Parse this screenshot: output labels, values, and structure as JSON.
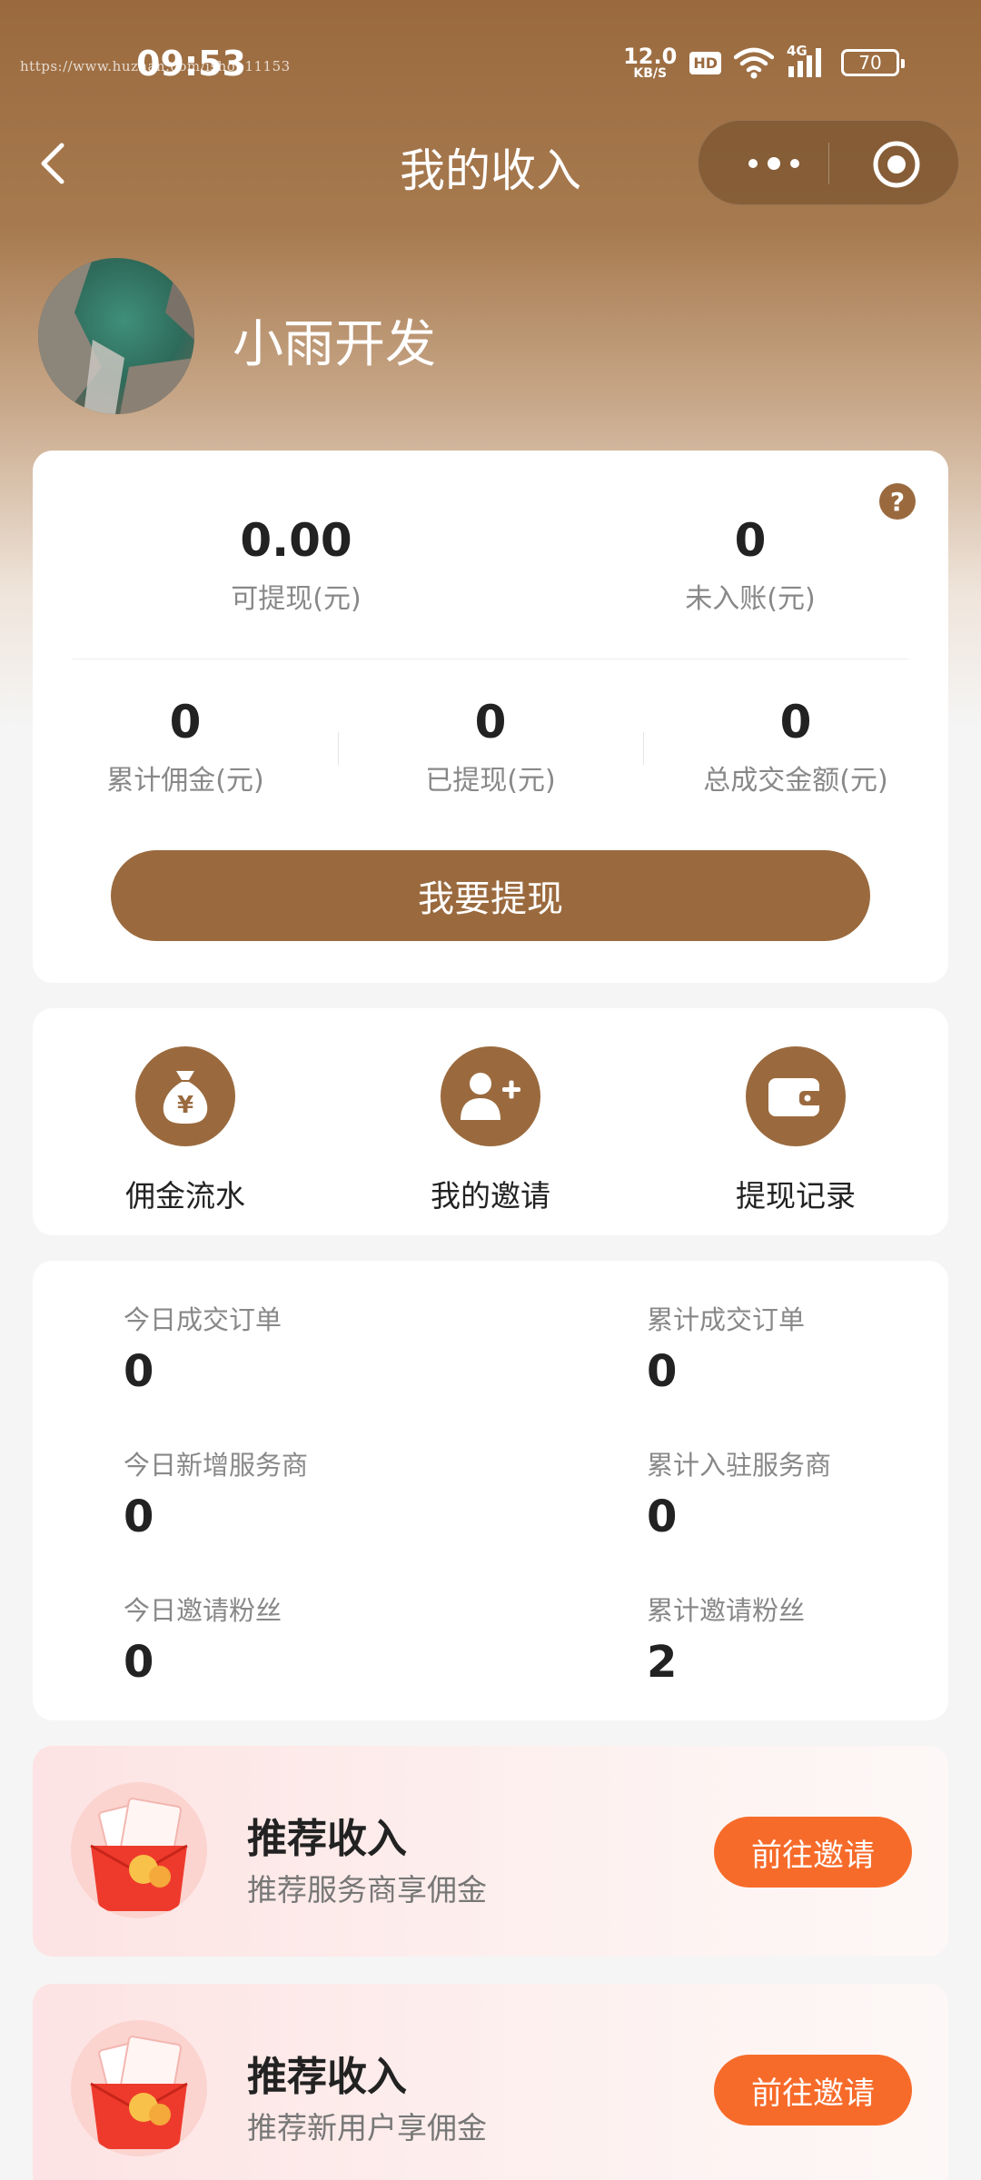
{
  "status_bar": {
    "time": "09:53",
    "watermark": "https://www.huzhan.com/ishop11153",
    "net_speed_value": "12.0",
    "net_speed_unit": "KB/S",
    "hd": "HD",
    "signal": "4G",
    "battery": "70"
  },
  "nav": {
    "title": "我的收入",
    "icons": [
      "back-icon",
      "more-icon",
      "close-target-icon"
    ]
  },
  "profile": {
    "name": "小雨开发"
  },
  "stats": {
    "help": "?",
    "withdrawable": {
      "value": "0.00",
      "label": "可提现(元)"
    },
    "pending": {
      "value": "0",
      "label": "未入账(元)"
    },
    "total_commission": {
      "value": "0",
      "label": "累计佣金(元)"
    },
    "withdrawn": {
      "value": "0",
      "label": "已提现(元)"
    },
    "total_deal": {
      "value": "0",
      "label": "总成交金额(元)"
    },
    "withdraw_button": "我要提现"
  },
  "menu": {
    "items": [
      {
        "label": "佣金流水",
        "icon": "money-bag-icon"
      },
      {
        "label": "我的邀请",
        "icon": "add-user-icon"
      },
      {
        "label": "提现记录",
        "icon": "wallet-icon"
      }
    ]
  },
  "data_panel": {
    "today_orders": {
      "label": "今日成交订单",
      "value": "0"
    },
    "total_orders": {
      "label": "累计成交订单",
      "value": "0"
    },
    "today_new_providers": {
      "label": "今日新增服务商",
      "value": "0"
    },
    "total_providers": {
      "label": "累计入驻服务商",
      "value": "0"
    },
    "today_fans": {
      "label": "今日邀请粉丝",
      "value": "0"
    },
    "total_fans": {
      "label": "累计邀请粉丝",
      "value": "2"
    }
  },
  "promos": [
    {
      "title": "推荐收入",
      "subtitle": "推荐服务商享佣金",
      "button": "前往邀请",
      "icon": "red-envelope-icon"
    },
    {
      "title": "推荐收入",
      "subtitle": "推荐新用户享佣金",
      "button": "前往邀请",
      "icon": "red-envelope-icon"
    }
  ],
  "colors": {
    "brand": "#9a6a3e",
    "accent_orange": "#f76b2a",
    "promo_bg": "#fde3e3"
  }
}
